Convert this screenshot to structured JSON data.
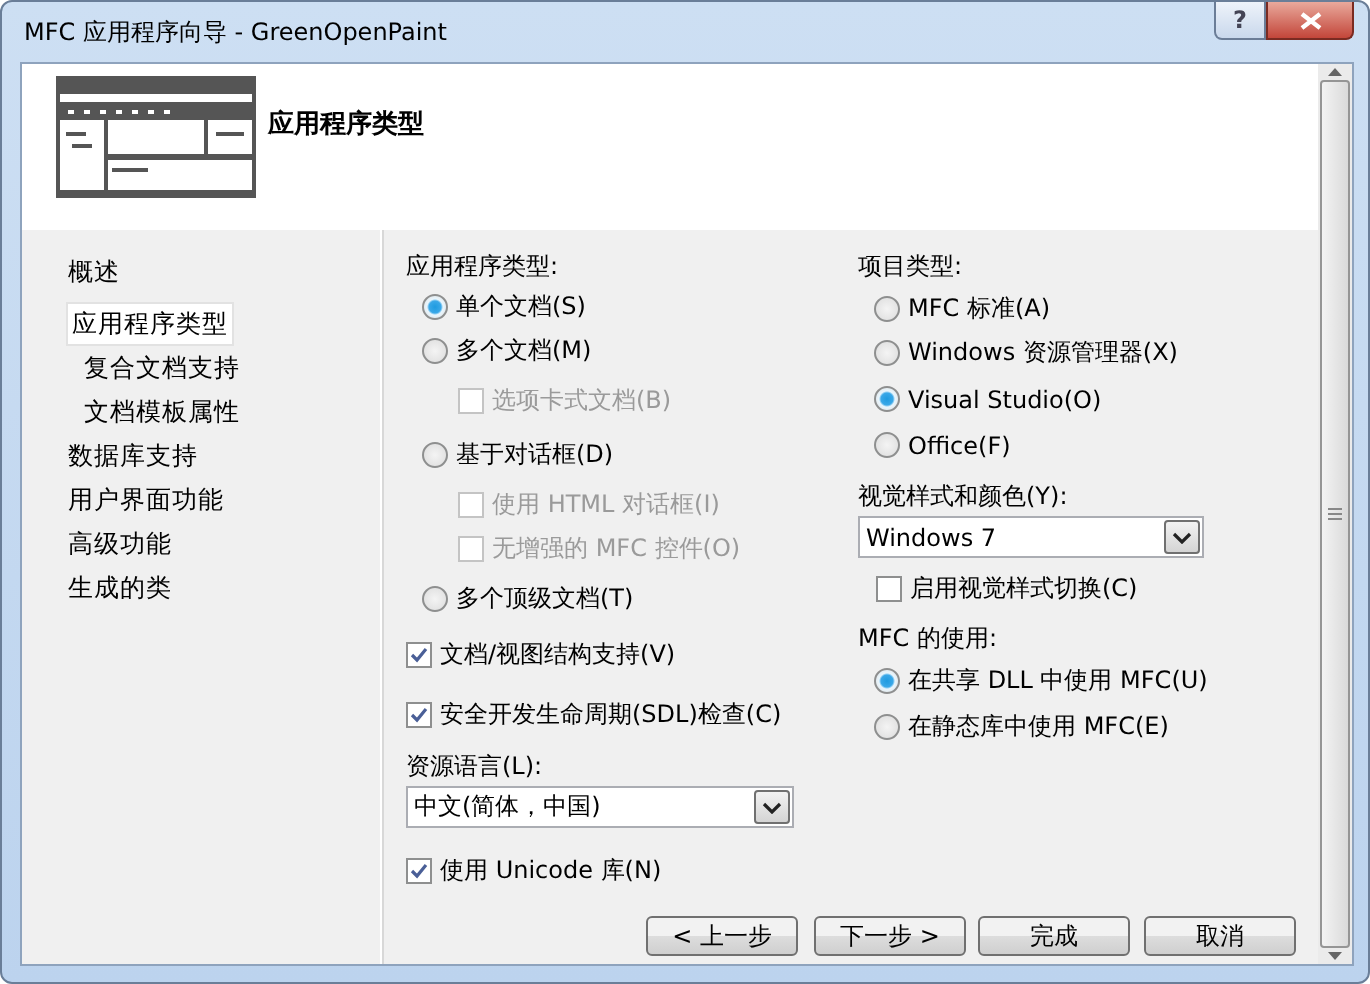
{
  "window": {
    "title": "MFC 应用程序向导 - GreenOpenPaint",
    "help": "?"
  },
  "header": {
    "title": "应用程序类型"
  },
  "nav": [
    {
      "label": "概述",
      "selected": false
    },
    {
      "label": "应用程序类型",
      "selected": true,
      "children": [
        {
          "label": "复合文档支持",
          "selected": false
        },
        {
          "label": "文档模板属性",
          "selected": false
        }
      ]
    },
    {
      "label": "数据库支持",
      "selected": false
    },
    {
      "label": "用户界面功能",
      "selected": false
    },
    {
      "label": "高级功能",
      "selected": false
    },
    {
      "label": "生成的类",
      "selected": false
    }
  ],
  "app_type": {
    "label": "应用程序类型:",
    "options": [
      {
        "label": "单个文档(S)",
        "selected": true
      },
      {
        "label": "多个文档(M)",
        "selected": false,
        "children": [
          {
            "label": "选项卡式文档(B)",
            "checked": false,
            "disabled": true
          }
        ]
      },
      {
        "label": "基于对话框(D)",
        "selected": false,
        "children": [
          {
            "label": "使用 HTML 对话框(I)",
            "checked": false,
            "disabled": true
          },
          {
            "label": "无增强的 MFC 控件(O)",
            "checked": false,
            "disabled": true
          }
        ]
      },
      {
        "label": "多个顶级文档(T)",
        "selected": false
      }
    ]
  },
  "doc_options": [
    {
      "label": "文档/视图结构支持(V)",
      "checked": true
    },
    {
      "label": "安全开发生命周期(SDL)检查(C)",
      "checked": true
    }
  ],
  "resource_language": {
    "label": "资源语言(L):",
    "value": "中文(简体，中国)"
  },
  "unicode": {
    "label": "使用 Unicode 库(N)",
    "checked": true
  },
  "project_type": {
    "label": "项目类型:",
    "options": [
      {
        "label": "MFC 标准(A)",
        "selected": false
      },
      {
        "label": "Windows 资源管理器(X)",
        "selected": false
      },
      {
        "label": "Visual Studio(O)",
        "selected": true
      },
      {
        "label": "Office(F)",
        "selected": false
      }
    ]
  },
  "visual_style": {
    "label": "视觉样式和颜色(Y):",
    "value": "Windows 7",
    "toggle": {
      "label": "启用视觉样式切换(C)",
      "checked": false
    }
  },
  "mfc_use": {
    "label": "MFC 的使用:",
    "options": [
      {
        "label": "在共享 DLL 中使用 MFC(U)",
        "selected": true
      },
      {
        "label": "在静态库中使用 MFC(E)",
        "selected": false
      }
    ]
  },
  "buttons": [
    "< 上一步",
    "下一步 >",
    "完成",
    "取消"
  ]
}
